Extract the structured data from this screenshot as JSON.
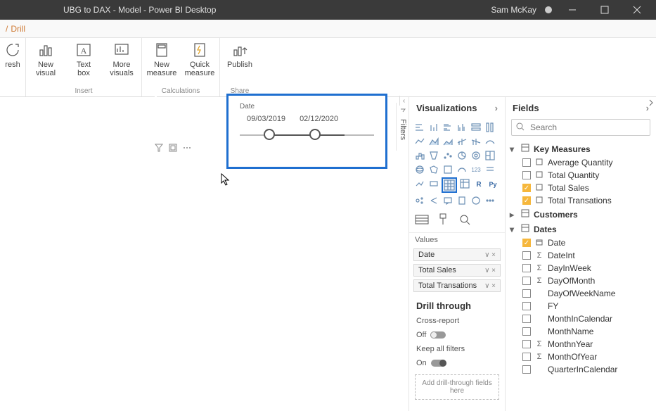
{
  "titlebar": {
    "title": "UBG to DAX - Model - Power BI Desktop",
    "user": "Sam McKay"
  },
  "breadcrumb": {
    "leading_sep": "/",
    "item": "Drill"
  },
  "ribbon": {
    "refresh": "resh",
    "insert": {
      "new_visual": "New\nvisual",
      "text_box": "Text\nbox",
      "more_visuals": "More\nvisuals",
      "group_label": "Insert"
    },
    "calculations": {
      "new_measure": "New\nmeasure",
      "quick_measure": "Quick\nmeasure",
      "group_label": "Calculations"
    },
    "share": {
      "publish": "Publish",
      "group_label": "Share"
    }
  },
  "canvas": {
    "visual_header_icons": [
      "filter-icon",
      "focus-icon",
      "more-icon"
    ],
    "slicer": {
      "title": "Date",
      "start": "09/03/2019",
      "end": "02/12/2020"
    },
    "filters_tab_label": "Filters"
  },
  "visualizations": {
    "title": "Visualizations",
    "values_label": "Values",
    "wells": [
      "Date",
      "Total Sales",
      "Total Transations"
    ],
    "drillthrough": {
      "title": "Drill through",
      "cross_report_label": "Cross-report",
      "cross_report_state": "Off",
      "keep_filters_label": "Keep all filters",
      "keep_filters_state": "On",
      "drop_hint": "Add drill-through fields here"
    }
  },
  "fields": {
    "title": "Fields",
    "search_placeholder": "Search",
    "groups": [
      {
        "name": "Key Measures",
        "expanded": true,
        "items": [
          {
            "label": "Average Quantity",
            "checked": false,
            "type": "measure"
          },
          {
            "label": "Total Quantity",
            "checked": false,
            "type": "measure"
          },
          {
            "label": "Total Sales",
            "checked": true,
            "type": "measure"
          },
          {
            "label": "Total Transations",
            "checked": true,
            "type": "measure"
          }
        ]
      },
      {
        "name": "Customers",
        "expanded": false,
        "items": []
      },
      {
        "name": "Dates",
        "expanded": true,
        "items": [
          {
            "label": "Date",
            "checked": true,
            "type": "date"
          },
          {
            "label": "DateInt",
            "checked": false,
            "type": "sigma"
          },
          {
            "label": "DayInWeek",
            "checked": false,
            "type": "sigma"
          },
          {
            "label": "DayOfMonth",
            "checked": false,
            "type": "sigma"
          },
          {
            "label": "DayOfWeekName",
            "checked": false,
            "type": ""
          },
          {
            "label": "FY",
            "checked": false,
            "type": ""
          },
          {
            "label": "MonthInCalendar",
            "checked": false,
            "type": ""
          },
          {
            "label": "MonthName",
            "checked": false,
            "type": ""
          },
          {
            "label": "MonthnYear",
            "checked": false,
            "type": "sigma"
          },
          {
            "label": "MonthOfYear",
            "checked": false,
            "type": "sigma"
          },
          {
            "label": "QuarterInCalendar",
            "checked": false,
            "type": ""
          }
        ]
      }
    ]
  }
}
